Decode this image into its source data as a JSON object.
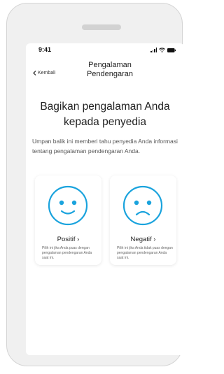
{
  "status_bar": {
    "time": "9:41"
  },
  "nav": {
    "back_label": "Kembali",
    "title": "Pengalaman Pendengaran"
  },
  "main": {
    "heading": "Bagikan pengalaman Anda kepada penyedia",
    "description": "Umpan balik ini memberi tahu penyedia Anda informasi tentang pengalaman pendengaran Anda."
  },
  "options": {
    "positive": {
      "label": "Positif ›",
      "description": "Pilih ini jika Anda puas dengan pengalaman pendengaran Anda saat ini.",
      "icon": "happy-face-icon"
    },
    "negative": {
      "label": "Negatif ›",
      "description": "Pilih ini jika Anda tidak puas dengan pengalaman pendengaran Anda saat ini.",
      "icon": "sad-face-icon"
    }
  },
  "colors": {
    "accent": "#1aa3dd",
    "text": "#222222",
    "phone_frame": "#f0f0f0"
  }
}
